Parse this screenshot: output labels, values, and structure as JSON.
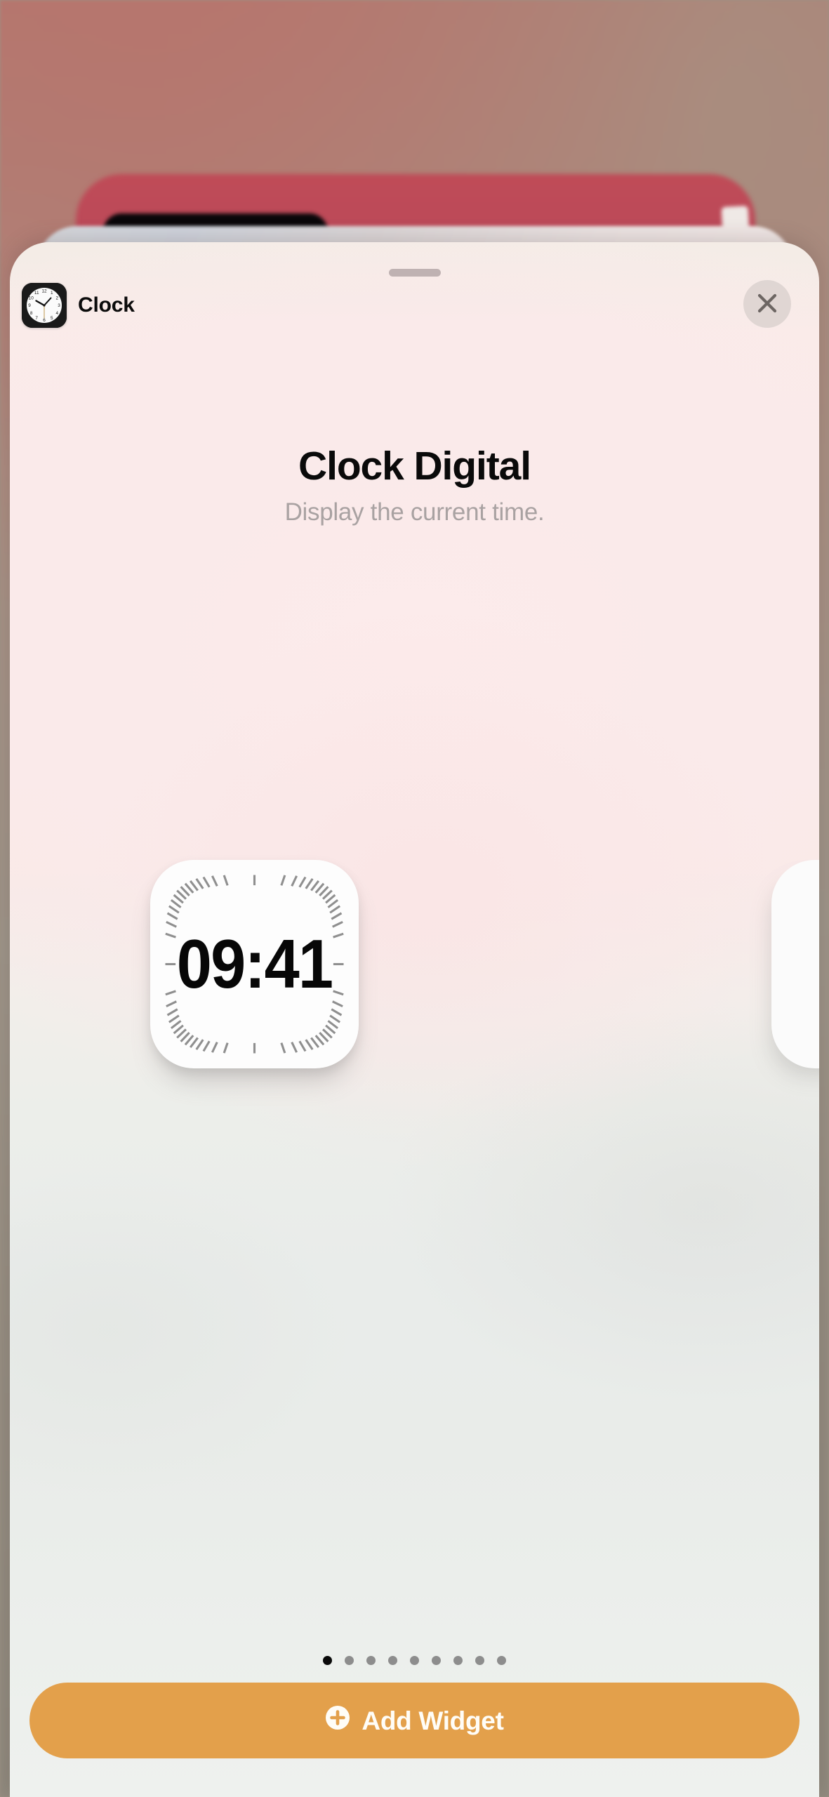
{
  "sheet": {
    "app": {
      "name": "Clock",
      "icon": "clock-app-icon"
    },
    "grabber": "sheet-grabber",
    "close": {
      "icon": "close-icon",
      "label": "Close"
    },
    "title": "Clock Digital",
    "subtitle": "Display the current time.",
    "widget_preview": {
      "time": "09:41",
      "style": "clock-bezel-ticks",
      "tick_count": 60
    },
    "pagination": {
      "total": 9,
      "active_index": 0
    },
    "add_button": {
      "label": "Add Widget",
      "icon": "plus-circle-icon"
    }
  },
  "colors": {
    "accent_orange": "#e3a04b",
    "sheet_top": "#fbeaea",
    "sheet_bottom": "#eef1ee",
    "title_text": "#0a0a0a",
    "subtitle_text": "#a9a2a2",
    "dot_active": "#0a0a0a",
    "dot_inactive": "#8d8d8d",
    "background_card_red": "#b9485a",
    "wallpaper": "#9d9488"
  }
}
